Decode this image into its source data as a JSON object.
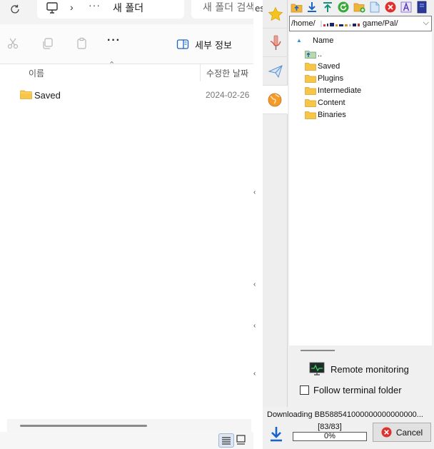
{
  "explorer": {
    "breadcrumb_more": "···",
    "breadcrumb_chevron": "›",
    "current_folder": "새 폴더",
    "search_placeholder": "새 폴더 검색",
    "toolbar": {
      "more_label": "···",
      "details_label": "세부 정보"
    },
    "columns": {
      "name": "이름",
      "date": "수정한 날짜"
    },
    "files": [
      {
        "name": "Saved",
        "date": "2024-02-26"
      }
    ]
  },
  "gap_text": "es",
  "sftp": {
    "path": "/home/",
    "path_tail": "game/Pal/",
    "list_header": "Name",
    "items": [
      {
        "name": "..",
        "icon": "parent-folder-icon"
      },
      {
        "name": "Saved",
        "icon": "folder-icon"
      },
      {
        "name": "Plugins",
        "icon": "folder-icon"
      },
      {
        "name": "Intermediate",
        "icon": "folder-icon"
      },
      {
        "name": "Content",
        "icon": "folder-icon"
      },
      {
        "name": "Binaries",
        "icon": "folder-icon"
      }
    ],
    "remote_monitoring_label": "Remote monitoring",
    "follow_terminal_label": "Follow terminal folder",
    "follow_terminal_checked": false,
    "transfer": {
      "downloading_text": "Downloading BB588541000000000000000...",
      "count": "[83/83]",
      "percent_label": "0%",
      "progress": 0,
      "cancel_label": "Cancel"
    }
  },
  "colors": {
    "folder": "#f6c648",
    "progress": "#3c9a3c",
    "cancel_red": "#e0302e",
    "accent_blue": "#1a64c8"
  }
}
